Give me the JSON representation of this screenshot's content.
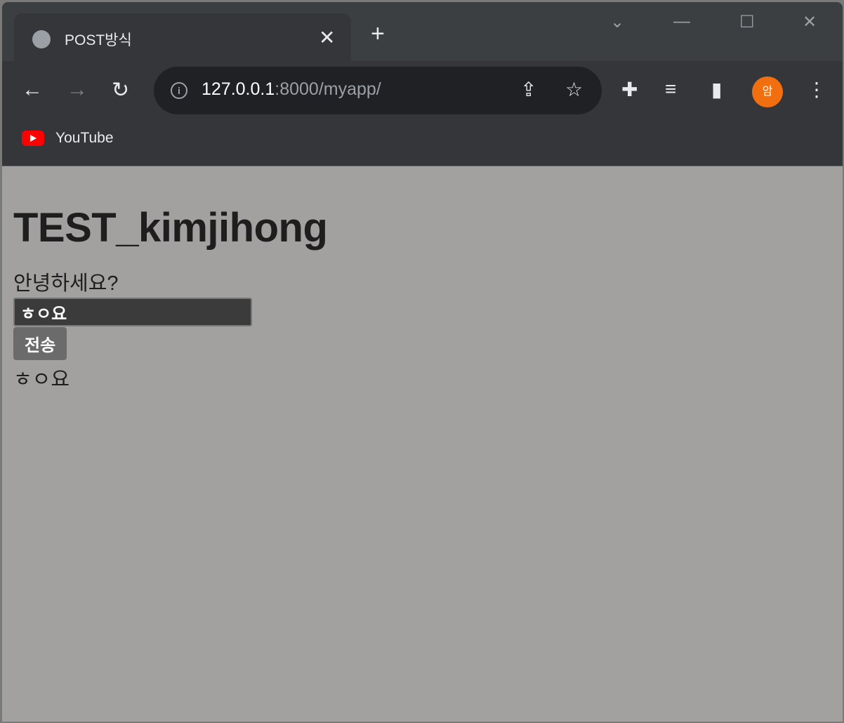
{
  "browser": {
    "tab_title": "POST방식",
    "url_host": "127.0.0.1",
    "url_rest": ":8000/myapp/",
    "bookmarks": [
      {
        "label": "YouTube"
      }
    ],
    "profile_initial": "암"
  },
  "page": {
    "heading": "TEST_kimjihong",
    "greeting": "안녕하세요?",
    "input_value": "ㅎㅇ요",
    "submit_label": "전송",
    "result_text": "ㅎㅇ요"
  }
}
